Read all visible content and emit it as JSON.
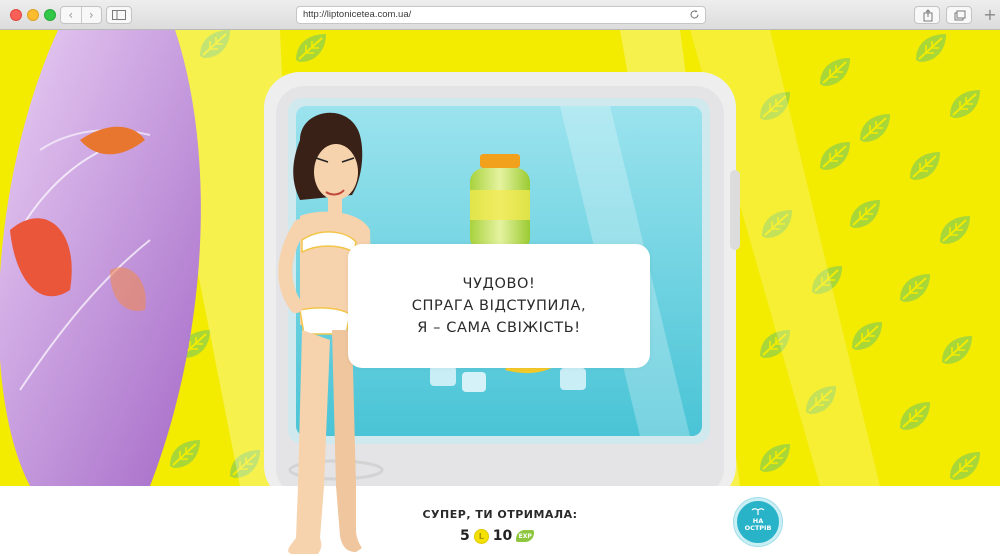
{
  "browser": {
    "url": "http://liptonicetea.com.ua/",
    "nav_back": "‹",
    "nav_forward": "›",
    "new_tab": "+"
  },
  "game": {
    "speech_lines": [
      "ЧУДОВО!",
      "СПРАГА ВІДСТУПИЛА,",
      "Я – САМА СВІЖІСТЬ!"
    ],
    "reward_title": "СУПЕР, ТИ ОТРИМАЛА:",
    "coins_value": "5",
    "coin_icon_label": "L",
    "exp_value": "10",
    "exp_label": "EXP",
    "island_button": {
      "line1": "НА",
      "line2": "ОСТРІВ"
    }
  },
  "colors": {
    "background_yellow": "#f3eb00",
    "leaf_green": "#9fd33a",
    "fridge_interior": "#7fd7e6",
    "surfboard_purple": "#b682d6",
    "island_button": "#29b3c9"
  }
}
